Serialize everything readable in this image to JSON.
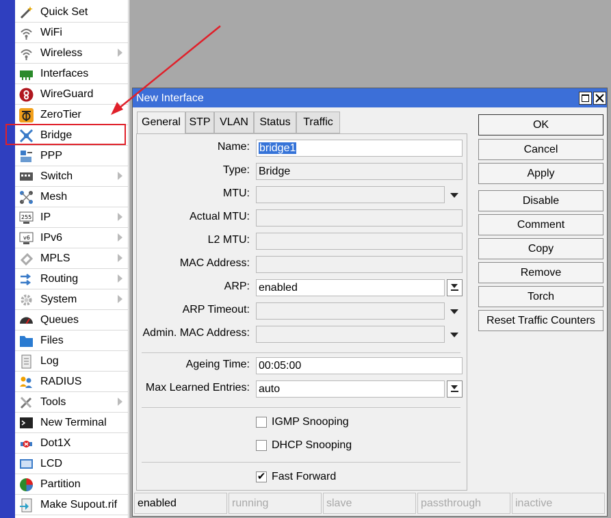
{
  "menu": {
    "items": [
      {
        "label": "Quick Set",
        "icon": "magic-wand-icon",
        "submenu": false
      },
      {
        "label": "WiFi",
        "icon": "wifi-icon",
        "submenu": false
      },
      {
        "label": "Wireless",
        "icon": "wireless-icon",
        "submenu": true
      },
      {
        "label": "Interfaces",
        "icon": "interfaces-icon",
        "submenu": false
      },
      {
        "label": "WireGuard",
        "icon": "wireguard-icon",
        "submenu": false
      },
      {
        "label": "ZeroTier",
        "icon": "zerotier-icon",
        "submenu": false
      },
      {
        "label": "Bridge",
        "icon": "bridge-icon",
        "submenu": false
      },
      {
        "label": "PPP",
        "icon": "ppp-icon",
        "submenu": false
      },
      {
        "label": "Switch",
        "icon": "switch-icon",
        "submenu": true
      },
      {
        "label": "Mesh",
        "icon": "mesh-icon",
        "submenu": false
      },
      {
        "label": "IP",
        "icon": "ip-icon",
        "submenu": true
      },
      {
        "label": "IPv6",
        "icon": "ipv6-icon",
        "submenu": true
      },
      {
        "label": "MPLS",
        "icon": "mpls-icon",
        "submenu": true
      },
      {
        "label": "Routing",
        "icon": "routing-icon",
        "submenu": true
      },
      {
        "label": "System",
        "icon": "gear-icon",
        "submenu": true
      },
      {
        "label": "Queues",
        "icon": "queues-icon",
        "submenu": false
      },
      {
        "label": "Files",
        "icon": "folder-icon",
        "submenu": false
      },
      {
        "label": "Log",
        "icon": "log-icon",
        "submenu": false
      },
      {
        "label": "RADIUS",
        "icon": "radius-icon",
        "submenu": false
      },
      {
        "label": "Tools",
        "icon": "tools-icon",
        "submenu": true
      },
      {
        "label": "New Terminal",
        "icon": "terminal-icon",
        "submenu": false
      },
      {
        "label": "Dot1X",
        "icon": "dot1x-icon",
        "submenu": false
      },
      {
        "label": "LCD",
        "icon": "lcd-icon",
        "submenu": false
      },
      {
        "label": "Partition",
        "icon": "partition-icon",
        "submenu": false
      },
      {
        "label": "Make Supout.rif",
        "icon": "supout-icon",
        "submenu": false
      }
    ]
  },
  "dialog": {
    "title": "New Interface",
    "tabs": [
      "General",
      "STP",
      "VLAN",
      "Status",
      "Traffic"
    ],
    "fields": {
      "name": {
        "label": "Name:",
        "value": "bridge1"
      },
      "type": {
        "label": "Type:",
        "value": "Bridge"
      },
      "mtu": {
        "label": "MTU:",
        "value": ""
      },
      "actual_mtu": {
        "label": "Actual MTU:",
        "value": ""
      },
      "l2_mtu": {
        "label": "L2 MTU:",
        "value": ""
      },
      "mac_address": {
        "label": "MAC Address:",
        "value": ""
      },
      "arp": {
        "label": "ARP:",
        "value": "enabled"
      },
      "arp_timeout": {
        "label": "ARP Timeout:",
        "value": ""
      },
      "admin_mac": {
        "label": "Admin. MAC Address:",
        "value": ""
      },
      "ageing_time": {
        "label": "Ageing Time:",
        "value": "00:05:00"
      },
      "max_learned": {
        "label": "Max Learned Entries:",
        "value": "auto"
      }
    },
    "checkboxes": {
      "igmp_snooping": {
        "label": "IGMP Snooping",
        "checked": false
      },
      "dhcp_snooping": {
        "label": "DHCP Snooping",
        "checked": false
      },
      "fast_forward": {
        "label": "Fast Forward",
        "checked": true,
        "mark": "✔"
      }
    },
    "buttons": {
      "ok": "OK",
      "cancel": "Cancel",
      "apply": "Apply",
      "disable": "Disable",
      "comment": "Comment",
      "copy": "Copy",
      "remove": "Remove",
      "torch": "Torch",
      "reset_traffic": "Reset Traffic Counters"
    },
    "status_bar": {
      "enabled": "enabled",
      "running": "running",
      "slave": "slave",
      "passthrough": "passthrough",
      "inactive": "inactive"
    }
  },
  "colors": {
    "side_strip": "#2f3fbf",
    "title_bar": "#3c6fd8",
    "highlight_box": "#e0202a",
    "arrow": "#e0202a"
  }
}
